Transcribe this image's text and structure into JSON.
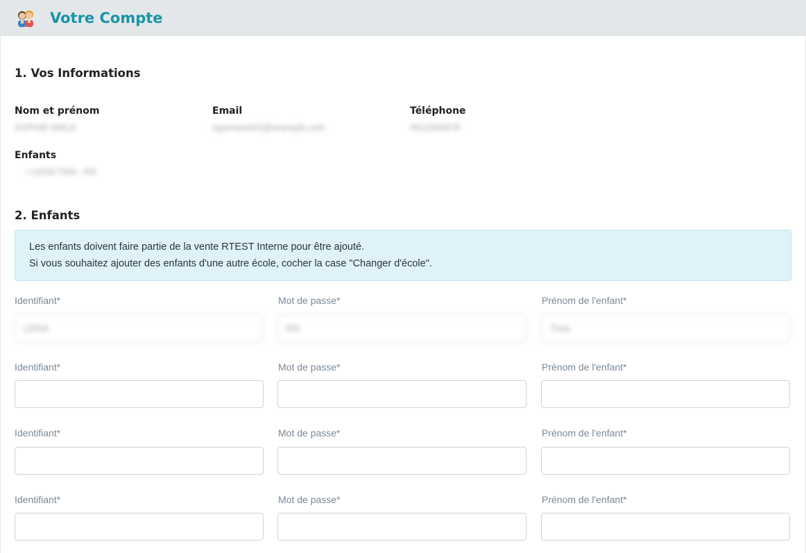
{
  "header": {
    "title": "Votre Compte",
    "icon": "parents-icon",
    "accent": "#1795a6"
  },
  "info": {
    "title": "1. Vos Informations",
    "name_label": "Nom et prénom",
    "name_value": "SOPHIE MALA",
    "email_label": "Email",
    "email_value": "sgormand15@example.com",
    "phone_label": "Téléphone",
    "phone_value": "0612345678",
    "children_label": "Enfants",
    "children_value": "• LENA TMA - RS"
  },
  "children": {
    "title": "2. Enfants",
    "alert_line1": "Les enfants doivent faire partie de la vente RTEST Interne pour être ajouté.",
    "alert_line2": "Si vous souhaitez ajouter des enfants d'une autre école, cocher la case \"Changer d'école\".",
    "rows": [
      {
        "id_label": "Identifiant*",
        "id_value": "LENA",
        "pwd_label": "Mot de passe*",
        "pwd_value": "RS",
        "name_label": "Prénom de l'enfant*",
        "name_value": "Tma"
      },
      {
        "id_label": "Identifiant*",
        "id_value": "",
        "pwd_label": "Mot de passe*",
        "pwd_value": "",
        "name_label": "Prénom de l'enfant*",
        "name_value": ""
      },
      {
        "id_label": "Identifiant*",
        "id_value": "",
        "pwd_label": "Mot de passe*",
        "pwd_value": "",
        "name_label": "Prénom de l'enfant*",
        "name_value": ""
      },
      {
        "id_label": "Identifiant*",
        "id_value": "",
        "pwd_label": "Mot de passe*",
        "pwd_value": "",
        "name_label": "Prénom de l'enfant*",
        "name_value": ""
      }
    ]
  }
}
